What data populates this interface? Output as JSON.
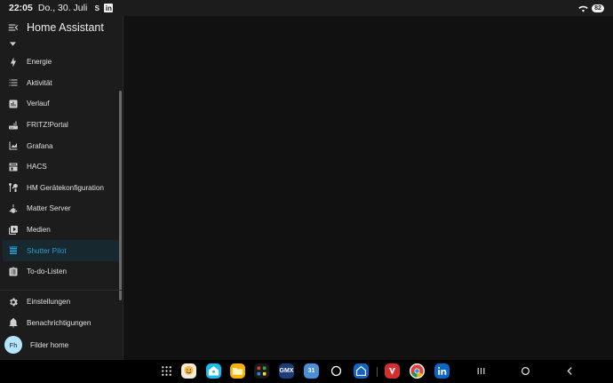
{
  "status_bar": {
    "time": "22:05",
    "date": "Do., 30. Juli",
    "notif_s": "S",
    "notif_li": "in",
    "battery": "82"
  },
  "header": {
    "title": "Home Assistant"
  },
  "sidebar": {
    "items": [
      {
        "label": "Energie",
        "icon": "lightning-icon"
      },
      {
        "label": "Aktivität",
        "icon": "list-icon"
      },
      {
        "label": "Verlauf",
        "icon": "chart-box-icon"
      },
      {
        "label": "FRITZ!Portal",
        "icon": "router-icon"
      },
      {
        "label": "Grafana",
        "icon": "chart-areaspline-icon"
      },
      {
        "label": "HACS",
        "icon": "hacs-icon"
      },
      {
        "label": "HM Gerätekonfiguration",
        "icon": "tools-icon"
      },
      {
        "label": "Matter Server",
        "icon": "matter-icon"
      },
      {
        "label": "Medien",
        "icon": "play-box-icon"
      },
      {
        "label": "Shutter Pilot",
        "icon": "shutter-icon",
        "active": true
      },
      {
        "label": "To-do-Listen",
        "icon": "clipboard-list-icon"
      }
    ],
    "bottom": [
      {
        "label": "Einstellungen",
        "icon": "cog-icon"
      },
      {
        "label": "Benachrichtigungen",
        "icon": "bell-icon"
      }
    ],
    "user": {
      "initials": "Fh",
      "name": "Filder home"
    }
  },
  "taskbar": {
    "gmx_label": "GMX",
    "calendar_label": "31"
  },
  "colors": {
    "accent": "#2d9ad0",
    "sidebar_bg": "#1c1c1c",
    "main_bg": "#111111",
    "avatar_bg": "#b3e5fc"
  }
}
